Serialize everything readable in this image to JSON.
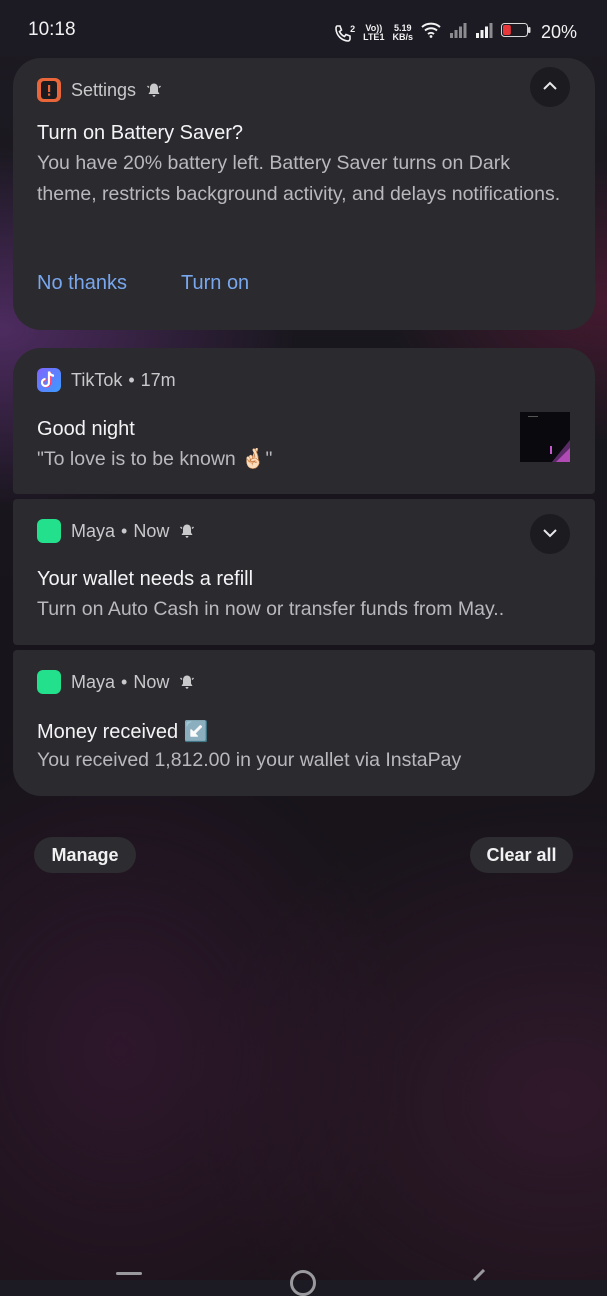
{
  "status_bar": {
    "time": "10:18",
    "call_sim": "2",
    "volte_top": "Vo))",
    "volte_bottom": "LTE1",
    "net_speed_value": "5.19",
    "net_speed_unit": "KB/s",
    "battery_level": 20,
    "battery_percent": "20%"
  },
  "settings_notification": {
    "app_name": "Settings",
    "title": "Turn on Battery Saver?",
    "body": "You have 20% battery left. Battery Saver turns on Dark theme, restricts background activity, and delays notifications.",
    "actions": [
      "No thanks",
      "Turn on"
    ]
  },
  "tiktok_notification": {
    "app_name": "TikTok",
    "time": "17m",
    "title": "Good night",
    "body": "\"To love is to be known 🤞🏻\""
  },
  "maya_notification_1": {
    "app_name": "Maya",
    "time": "Now",
    "title": "Your wallet needs a refill",
    "body": "Turn on Auto Cash in now or transfer funds from May.."
  },
  "maya_notification_2": {
    "app_name": "Maya",
    "time": "Now",
    "title": "Money received ↙️",
    "body": "You received 1,812.00 in your wallet via InstaPay"
  },
  "footer": {
    "manage_label": "Manage",
    "clear_all_label": "Clear all"
  },
  "colors": {
    "card": "#2b2a2e",
    "accent_action": "#78a7ee",
    "maya_green": "#22e08c",
    "settings_orange": "#e8663a",
    "battery_red": "#e8373b"
  }
}
